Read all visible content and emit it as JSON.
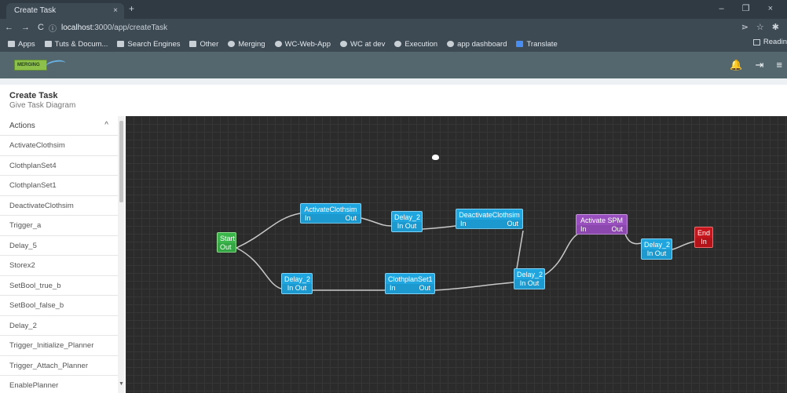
{
  "browser": {
    "tab_title": "Create Task",
    "tab_close": "×",
    "new_tab": "+",
    "window_controls": "– ❐ ×",
    "nav": {
      "back": "←",
      "forward": "→",
      "reload": "C"
    },
    "url_host": "localhost",
    "url_path": ":3000/app/createTask",
    "info_icon": "ⓘ",
    "right_icons": [
      "⋗",
      "☆",
      "✱"
    ],
    "bookmarks": [
      {
        "label": "Apps",
        "icon": "apps-icon"
      },
      {
        "label": "Tuts & Docum...",
        "icon": "folder-icon"
      },
      {
        "label": "Search Engines",
        "icon": "folder-icon"
      },
      {
        "label": "Other",
        "icon": "folder-icon"
      },
      {
        "label": "Merging",
        "icon": "github-icon"
      },
      {
        "label": "WC-Web-App",
        "icon": "github-icon"
      },
      {
        "label": "WC at dev",
        "icon": "github-icon"
      },
      {
        "label": "Execution",
        "icon": "globe-icon"
      },
      {
        "label": "app dashboard",
        "icon": "globe-icon"
      },
      {
        "label": "Translate",
        "icon": "translate-icon"
      }
    ],
    "reading_list": "Readin"
  },
  "app": {
    "logo_text": "MERGING",
    "header_icons": [
      "🔔",
      "⇥",
      "≡"
    ],
    "page_title": "Create Task",
    "page_subtitle": "Give Task Diagram"
  },
  "sidebar": {
    "header": "Actions",
    "chevron": "^",
    "items": [
      "ActivateClothsim",
      "ClothplanSet4",
      "ClothplanSet1",
      "DeactivateClothsim",
      "Trigger_a",
      "Delay_5",
      "Storex2",
      "SetBool_true_b",
      "SetBool_false_b",
      "Delay_2",
      "Trigger_Initialize_Planner",
      "Trigger_Attach_Planner",
      "EnablePlanner"
    ],
    "scroll_down": "▼"
  },
  "diagram": {
    "colors": {
      "task": "#1fa6e0",
      "start": "#39b54a",
      "special": "#9a4fbf",
      "end": "#c4161c",
      "link": "#c9c9c9"
    },
    "nodes": [
      {
        "id": "start",
        "title": "Start",
        "ports": [
          "",
          "Out"
        ],
        "kind": "green"
      },
      {
        "id": "activate-clothsim",
        "title": "ActivateClothsim",
        "ports": [
          "In",
          "Out"
        ],
        "kind": "blue"
      },
      {
        "id": "delay2-a",
        "title": "Delay_2",
        "ports": [
          "In Out",
          ""
        ],
        "kind": "blue"
      },
      {
        "id": "deactivate-clothsim",
        "title": "DeactivateClothsim",
        "ports": [
          "In",
          "Out"
        ],
        "kind": "blue"
      },
      {
        "id": "delay2-b",
        "title": "Delay_2",
        "ports": [
          "In Out",
          ""
        ],
        "kind": "blue"
      },
      {
        "id": "clothplanset1",
        "title": "ClothplanSet1",
        "ports": [
          "In",
          "Out"
        ],
        "kind": "blue"
      },
      {
        "id": "delay2-c",
        "title": "Delay_2",
        "ports": [
          "In Out",
          ""
        ],
        "kind": "blue"
      },
      {
        "id": "activate-spm",
        "title": "Activate SPM",
        "ports": [
          "In",
          "Out"
        ],
        "kind": "purple"
      },
      {
        "id": "delay2-d",
        "title": "Delay_2",
        "ports": [
          "In Out",
          ""
        ],
        "kind": "blue"
      },
      {
        "id": "end",
        "title": "End",
        "ports": [
          "In",
          ""
        ],
        "kind": "red"
      }
    ]
  }
}
